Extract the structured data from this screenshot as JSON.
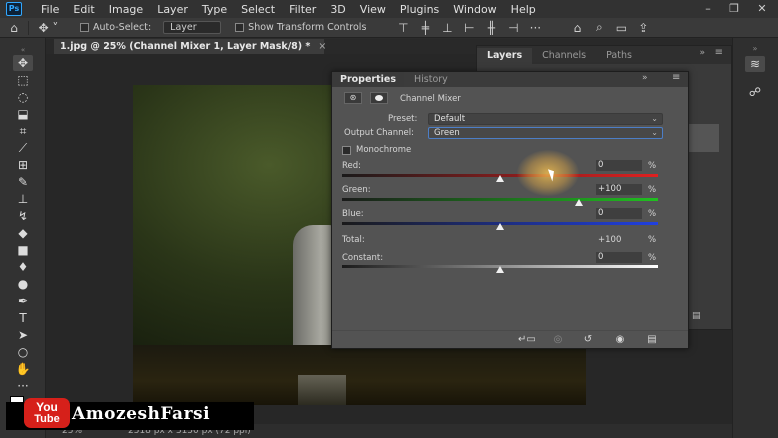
{
  "app": {
    "logo": "Ps"
  },
  "menu": [
    "File",
    "Edit",
    "Image",
    "Layer",
    "Type",
    "Select",
    "Filter",
    "3D",
    "View",
    "Plugins",
    "Window",
    "Help"
  ],
  "options_bar": {
    "auto_select_label": "Auto-Select:",
    "auto_select_value": "Layer",
    "show_transform_label": "Show Transform Controls"
  },
  "document": {
    "tab_title": "1.jpg @ 25% (Channel Mixer 1, Layer Mask/8) *",
    "close_glyph": "×"
  },
  "status": {
    "zoom": "25%",
    "dimensions": "2518 px x 3150 px (72 ppi)"
  },
  "layers_panel": {
    "tabs": [
      "Layers",
      "Channels",
      "Paths"
    ],
    "active": "Layers"
  },
  "properties": {
    "tabs": [
      "Properties",
      "History"
    ],
    "active_tab": "Properties",
    "adjustment_name": "Channel Mixer",
    "preset_label": "Preset:",
    "preset_value": "Default",
    "output_channel_label": "Output Channel:",
    "output_channel_value": "Green",
    "monochrome_label": "Monochrome",
    "monochrome_checked": false,
    "channels": [
      {
        "name": "Red:",
        "value": "0",
        "unit": "%",
        "color": "#e02020",
        "thumb_pct": 0.5
      },
      {
        "name": "Green:",
        "value": "+100",
        "unit": "%",
        "color": "#20c020",
        "thumb_pct": 0.75
      },
      {
        "name": "Blue:",
        "value": "0",
        "unit": "%",
        "color": "#2040e0",
        "thumb_pct": 0.5
      }
    ],
    "total_label": "Total:",
    "total_value": "+100",
    "total_unit": "%",
    "constant_label": "Constant:",
    "constant_value": "0",
    "constant_unit": "%",
    "constant_thumb_pct": 0.5
  },
  "watermark": {
    "yt_line1": "You",
    "yt_line2": "Tube",
    "text": "AmozeshFarsi"
  }
}
